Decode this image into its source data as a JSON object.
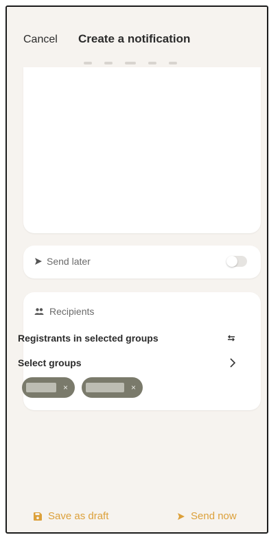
{
  "header": {
    "cancel_label": "Cancel",
    "title": "Create a notification"
  },
  "send_later": {
    "label": "Send later",
    "enabled": false
  },
  "recipients": {
    "label": "Recipients",
    "target_label": "Registrants in selected groups",
    "select_groups_label": "Select groups",
    "chips": [
      {
        "remove_glyph": "×"
      },
      {
        "remove_glyph": "×"
      }
    ]
  },
  "footer": {
    "draft_label": "Save as draft",
    "send_now_label": "Send now"
  },
  "colors": {
    "accent": "#dca03a",
    "chip_background": "#7a7a6b",
    "page_background": "#f6f3ef"
  },
  "icons": {
    "send_later": "send-icon",
    "recipients": "people-icon",
    "target_switch": "swap-arrows-icon",
    "select_groups": "chevron-right-icon",
    "draft": "save-icon",
    "send_now": "send-icon"
  }
}
